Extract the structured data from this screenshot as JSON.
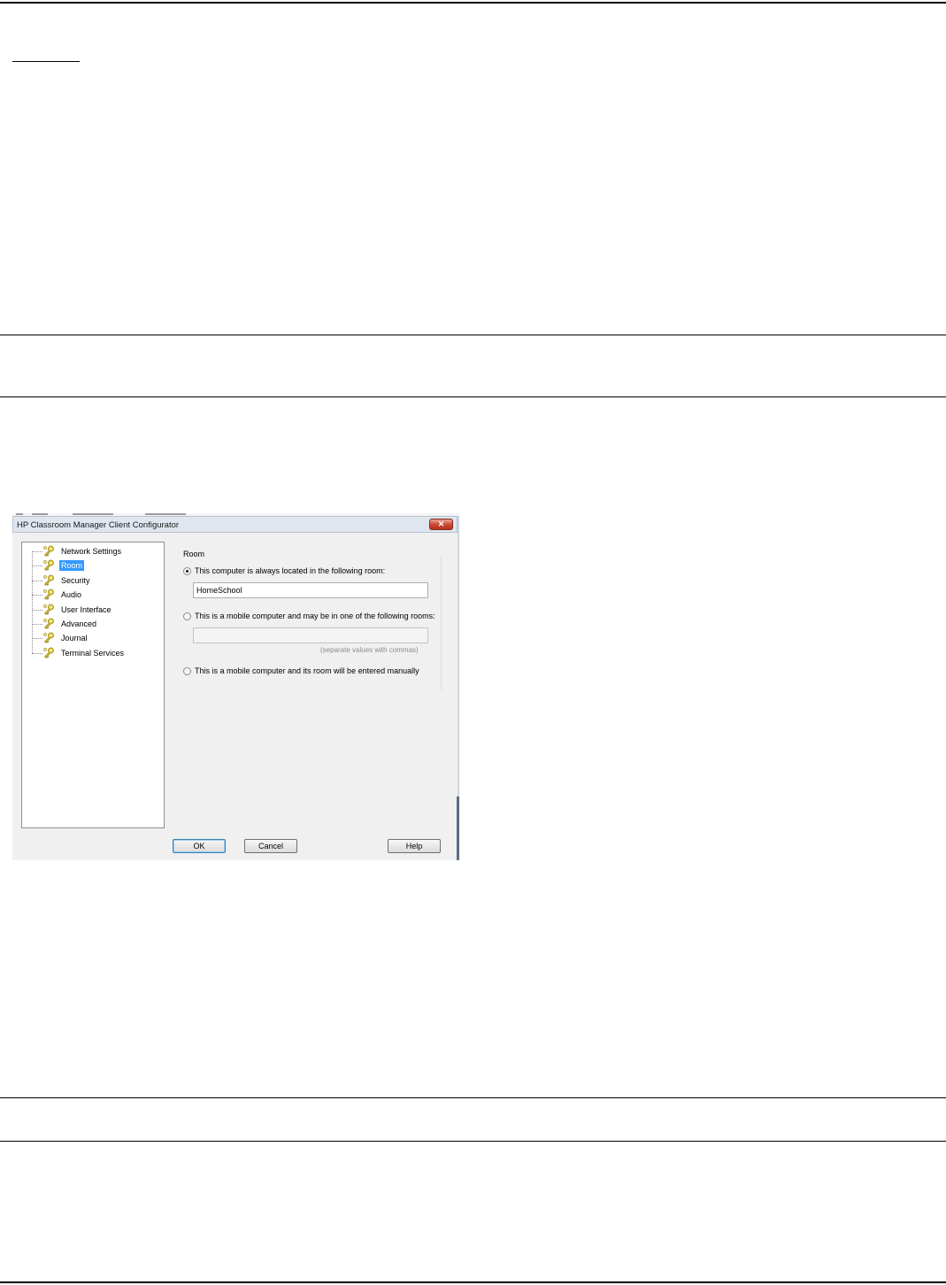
{
  "dialog": {
    "title": "HP Classroom Manager Client Configurator",
    "close_glyph": "✕",
    "tree_items": [
      {
        "label": "Network Settings",
        "selected": false
      },
      {
        "label": "Room",
        "selected": true
      },
      {
        "label": "Security",
        "selected": false
      },
      {
        "label": "Audio",
        "selected": false
      },
      {
        "label": "User Interface",
        "selected": false
      },
      {
        "label": "Advanced",
        "selected": false
      },
      {
        "label": "Journal",
        "selected": false
      },
      {
        "label": "Terminal Services",
        "selected": false
      }
    ],
    "group_title": "Room",
    "option_fixed_room": "This computer is always located in the following room:",
    "room_value": "HomeSchool",
    "option_mobile_list": "This is a mobile computer and may be in one of the following rooms:",
    "rooms_list_value": "",
    "rooms_hint": "(separate values with commas)",
    "option_mobile_manual": "This is a mobile computer and its room will be entered manually",
    "selected_option": "fixed_room",
    "buttons": {
      "ok": "OK",
      "cancel": "Cancel",
      "help": "Help"
    },
    "icon": "key-icon"
  }
}
